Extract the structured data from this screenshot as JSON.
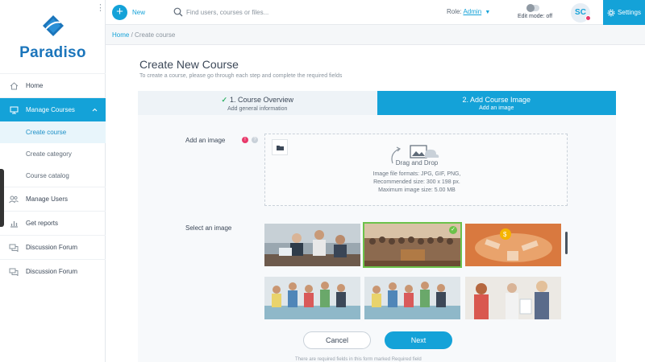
{
  "brand": {
    "name": "Paradiso",
    "accent": "#14a2d8"
  },
  "sidebar": {
    "items": [
      {
        "label": "Home"
      },
      {
        "label": "Manage Courses",
        "expanded": true
      },
      {
        "label": "Manage Users"
      },
      {
        "label": "Get reports"
      },
      {
        "label": "Discussion Forum"
      },
      {
        "label": "Discussion Forum"
      }
    ],
    "subitems": [
      {
        "label": "Create course",
        "active": true
      },
      {
        "label": "Create category"
      },
      {
        "label": "Course catalog"
      }
    ]
  },
  "topbar": {
    "new_label": "New",
    "search_placeholder": "Find users, courses or files...",
    "role_label": "Role:",
    "role_value": "Admin",
    "edit_mode": "Edit mode: off",
    "avatar_initials": "SC",
    "settings_label": "Settings"
  },
  "breadcrumb": {
    "home": "Home",
    "separator": "/",
    "current": "Create course"
  },
  "page": {
    "title": "Create New Course",
    "subtitle": "To create a course, please go through each step and complete the required fields"
  },
  "steps": [
    {
      "title": "1. Course Overview",
      "subtitle": "Add general information",
      "completed": true
    },
    {
      "title": "2. Add Course Image",
      "subtitle": "Add an image",
      "active": true
    }
  ],
  "form": {
    "add_image_label": "Add an image",
    "required_mark": "!",
    "help_mark": "?",
    "dropzone": {
      "title": "Drag and Drop",
      "formats": "Image file formats: JPG, GIF, PNG,",
      "recommended": "Recommended size: 300 x 198 px.",
      "max_size": "Maximum image size: 5.00 MB"
    },
    "select_image_label": "Select an image",
    "gallery": [
      {
        "icon": "office-meeting-photo"
      },
      {
        "icon": "conference-audience-photo",
        "selected": true
      },
      {
        "icon": "team-hands-photo"
      },
      {
        "icon": "team-celebration-photo"
      },
      {
        "icon": "team-celebration-photo"
      },
      {
        "icon": "office-discussion-photo"
      }
    ]
  },
  "actions": {
    "cancel": "Cancel",
    "next": "Next"
  },
  "footnote": "There are required fields in this form marked Required field"
}
